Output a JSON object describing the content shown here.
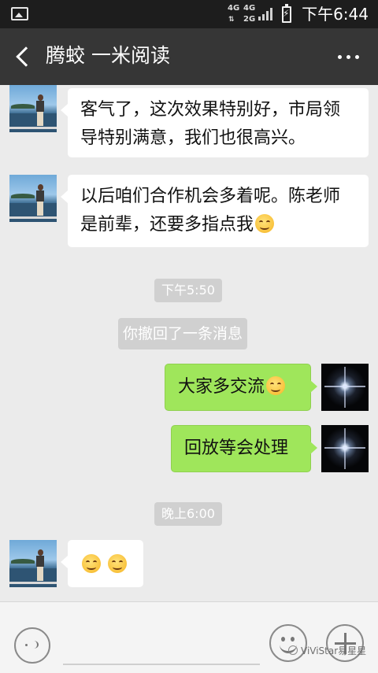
{
  "status_bar": {
    "net_top": "4G",
    "net_top2": "4G",
    "net_bottom": "2G",
    "time": "下午6:44"
  },
  "header": {
    "title": "腾蛟 一米阅读"
  },
  "messages": [
    {
      "side": "left",
      "text_line1": "客气了，这次效果特别好，市局领",
      "text_line2": "导特别满意，我们也很高兴。"
    },
    {
      "side": "left",
      "text_line1": "以后咱们合作机会多着呢。陈老师",
      "text_line2": "是前辈，还要多指点我"
    },
    {
      "time": "下午5:50"
    },
    {
      "system": "你撤回了一条消息"
    },
    {
      "side": "right",
      "text": "大家多交流"
    },
    {
      "side": "right",
      "text": "回放等会处理"
    },
    {
      "time": "晚上6:00"
    },
    {
      "side": "left",
      "emoji_only": true
    }
  ],
  "input_bar": {
    "watermark": "ViViStar易星星"
  },
  "icons": {
    "gallery": "image-icon",
    "back": "back-arrow-icon",
    "more": "more-dots-icon",
    "voice": "voice-icon",
    "emoji": "emoji-icon",
    "plus": "plus-icon"
  }
}
